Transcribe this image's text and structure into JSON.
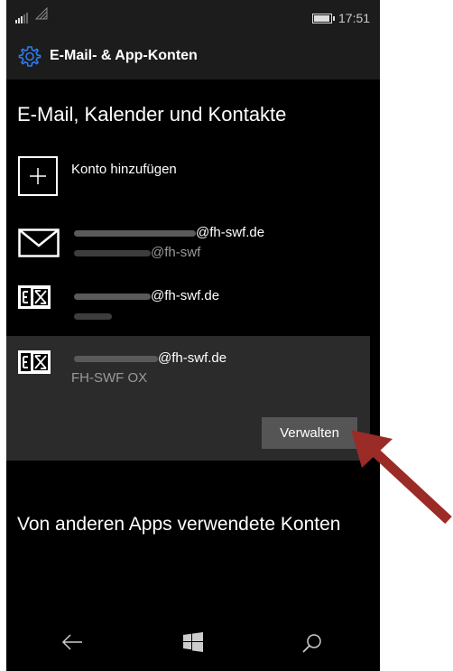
{
  "status_bar": {
    "time": "17:51"
  },
  "app_header": {
    "title": "E-Mail- & App-Konten",
    "icon": "gear-icon"
  },
  "section_email": {
    "title": "E-Mail, Kalender und Kontakte"
  },
  "add_account": {
    "label": "Konto hinzufügen"
  },
  "accounts": [
    {
      "icon": "envelope-icon",
      "primary": "@fh-swf.de",
      "secondary": "@fh-swf"
    },
    {
      "icon": "exchange-icon",
      "primary": "@fh-swf.de",
      "secondary": ""
    },
    {
      "icon": "exchange-icon",
      "primary": "@fh-swf.de",
      "secondary": "FH-SWF OX"
    }
  ],
  "manage_button": {
    "label": "Verwalten"
  },
  "section_other": {
    "title": "Von anderen Apps verwendete Konten"
  },
  "colors": {
    "background": "#000000",
    "panel": "#2b2b2b",
    "button": "#555555",
    "arrow": "#9b2b27"
  }
}
